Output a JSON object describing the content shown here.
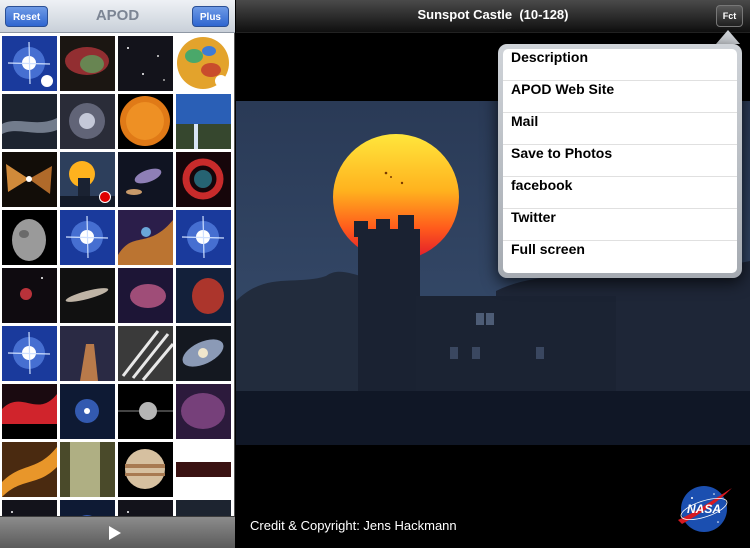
{
  "left_panel": {
    "title": "APOD",
    "reset_label": "Reset",
    "plus_label": "Plus",
    "thumbnails": [
      {
        "name": "starburst-galaxy",
        "theme": "blue-star",
        "badge": "white"
      },
      {
        "name": "nebula-red-green",
        "theme": "nebula-rg"
      },
      {
        "name": "dark-starfield",
        "theme": "starfield"
      },
      {
        "name": "lunar-topography-map",
        "theme": "moon-map",
        "badge": "white"
      },
      {
        "name": "milky-way-band",
        "theme": "milkyway"
      },
      {
        "name": "star-cluster",
        "theme": "cluster"
      },
      {
        "name": "sun-disk",
        "theme": "sun"
      },
      {
        "name": "waterfall-landscape",
        "theme": "landscape"
      },
      {
        "name": "butterfly-nebula",
        "theme": "butterfly"
      },
      {
        "name": "sunspot-castle",
        "theme": "castle",
        "badge": "red"
      },
      {
        "name": "galaxy-field",
        "theme": "galaxyfield"
      },
      {
        "name": "red-ring-nebula",
        "theme": "ringnebula"
      },
      {
        "name": "asteroid",
        "theme": "asteroid"
      },
      {
        "name": "starburst-galaxy-2",
        "theme": "blue-star"
      },
      {
        "name": "orange-nebula",
        "theme": "orangenebula"
      },
      {
        "name": "starburst-galaxy-3",
        "theme": "blue-star"
      },
      {
        "name": "small-red-nebula",
        "theme": "smallred"
      },
      {
        "name": "edge-on-galaxy",
        "theme": "edgeon"
      },
      {
        "name": "pink-nebula",
        "theme": "pinknebula"
      },
      {
        "name": "red-cloud-nebula",
        "theme": "redcloud"
      },
      {
        "name": "starburst-galaxy-4",
        "theme": "blue-star"
      },
      {
        "name": "pillar-nebula",
        "theme": "pillar"
      },
      {
        "name": "light-streaks",
        "theme": "streaks"
      },
      {
        "name": "spiral-galaxy",
        "theme": "spiral"
      },
      {
        "name": "red-aurora-tree",
        "theme": "redaurora"
      },
      {
        "name": "blue-nebula-cluster",
        "theme": "bluecluster"
      },
      {
        "name": "moon-orbit-diagram",
        "theme": "moonorbit"
      },
      {
        "name": "purple-nebula",
        "theme": "purplenebula"
      },
      {
        "name": "orange-streak-nebula",
        "theme": "orangestreak"
      },
      {
        "name": "waterfall-curtain",
        "theme": "curtain"
      },
      {
        "name": "jupiter",
        "theme": "jupiter"
      },
      {
        "name": "dark-red-strip",
        "theme": "darkstrip"
      },
      {
        "name": "partial-row-1",
        "theme": "starfield"
      },
      {
        "name": "partial-row-2",
        "theme": "bluecluster"
      },
      {
        "name": "partial-row-3",
        "theme": "starfield"
      },
      {
        "name": "partial-row-4",
        "theme": "milkyway"
      }
    ],
    "play_icon": "play-icon"
  },
  "right_panel": {
    "title": "Sunspot Castle  (10-128)",
    "fct_label": "Fct",
    "credit": "Credit & Copyright: Jens Hackmann",
    "menu_items": [
      "Description",
      "APOD Web Site",
      "Mail",
      "Save to Photos",
      "facebook",
      "Twitter",
      "Full screen"
    ],
    "logo": "nasa-logo"
  },
  "colors": {
    "button_blue": "#2f66d0",
    "sun_yellow": "#ffd23a",
    "sun_red": "#e0182c",
    "sky": "#2d3f5c",
    "badge_red": "#e00000"
  }
}
